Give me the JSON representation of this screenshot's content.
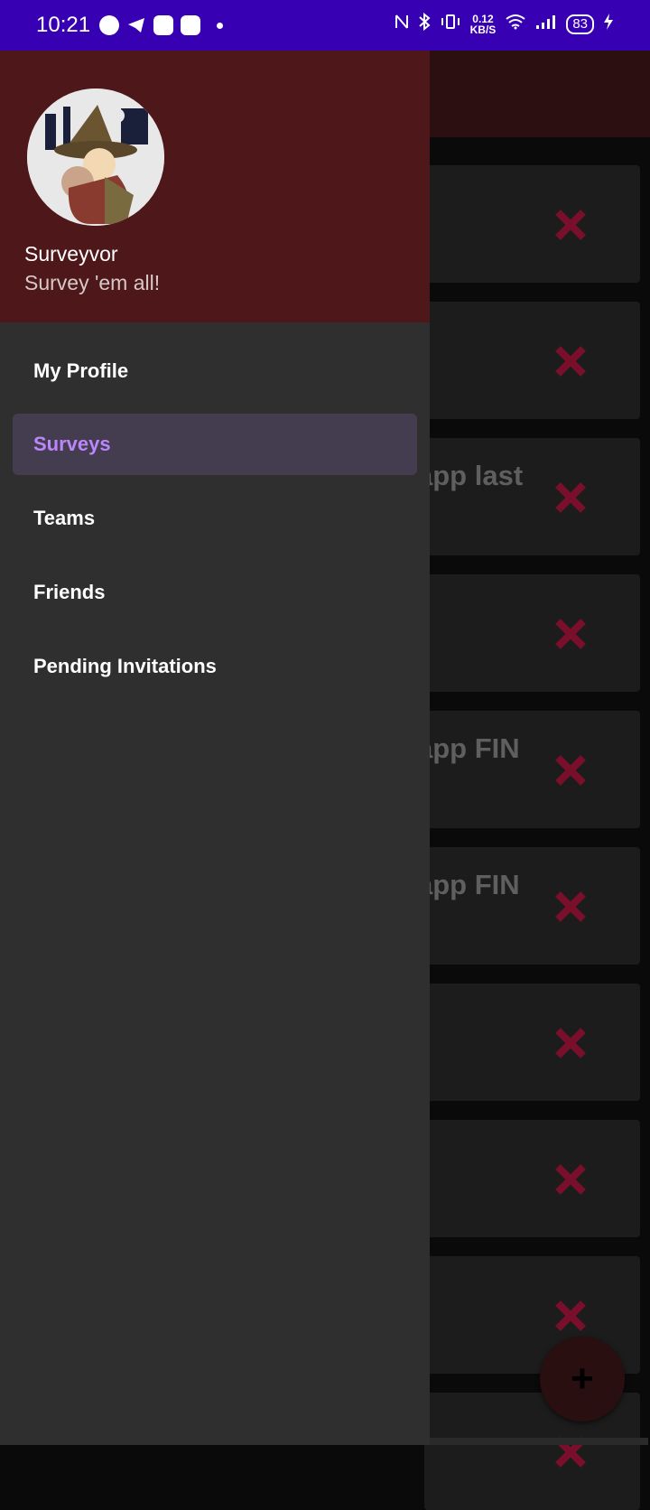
{
  "status_bar": {
    "time": "10:21",
    "speed_value": "0.12",
    "speed_unit": "KB/S",
    "battery": "83",
    "icons": [
      "spotify-icon",
      "telegram-icon",
      "discord-icon",
      "skype-icon",
      "nfc-icon",
      "bluetooth-icon",
      "vibrate-icon",
      "wifi-icon",
      "signal-icon",
      "charging-icon"
    ]
  },
  "drawer": {
    "header": {
      "name": "Surveyvor",
      "subtitle": "Survey 'em all!"
    },
    "items": [
      {
        "label": "My Profile",
        "active": false
      },
      {
        "label": "Surveys",
        "active": true
      },
      {
        "label": "Teams",
        "active": false
      },
      {
        "label": "Friends",
        "active": false
      },
      {
        "label": "Pending Invitations",
        "active": false
      }
    ]
  },
  "background": {
    "cards": [
      {
        "title": ""
      },
      {
        "title": ""
      },
      {
        "title": "app last"
      },
      {
        "title": ""
      },
      {
        "title": "app FIN"
      },
      {
        "title": "app FIN"
      },
      {
        "title": ""
      },
      {
        "title": ""
      },
      {
        "title": ""
      },
      {
        "title": ""
      }
    ],
    "fab_label": "+"
  },
  "colors": {
    "status_bar": "#3700b3",
    "drawer_header": "#4e181b",
    "drawer_bg": "#2f2f2f",
    "active_item_bg": "#443d4f",
    "active_item_text": "#bb86fc",
    "delete_icon": "#7a0f2b"
  }
}
